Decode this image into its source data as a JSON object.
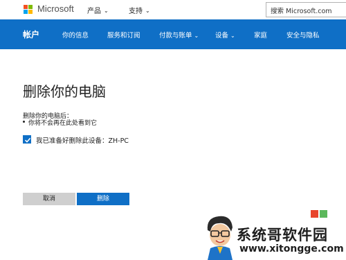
{
  "header": {
    "brand": "Microsoft",
    "nav": [
      {
        "label": "产品",
        "has_dropdown": true
      },
      {
        "label": "支持",
        "has_dropdown": true
      }
    ],
    "search_text": "搜索 Microsoft.com",
    "logo_colors": [
      "#f25022",
      "#7fba00",
      "#00a4ef",
      "#ffb900"
    ]
  },
  "account_nav": {
    "title": "帐户",
    "items": [
      {
        "label": "你的信息",
        "has_dropdown": false
      },
      {
        "label": "服务和订阅",
        "has_dropdown": false
      },
      {
        "label": "付款与账单",
        "has_dropdown": true
      },
      {
        "label": "设备",
        "has_dropdown": true
      },
      {
        "label": "家庭",
        "has_dropdown": false
      },
      {
        "label": "安全与隐私",
        "has_dropdown": false
      }
    ],
    "background": "#0f6fc6"
  },
  "main": {
    "heading": "删除你的电脑",
    "after_label": "删除你的电脑后：",
    "bullets": [
      "你将不会再在此处看到它"
    ],
    "confirm_checkbox": {
      "label": "我已准备好删除此设备：ZH-PC",
      "checked": true
    },
    "cancel_label": "取消",
    "delete_label": "删除"
  },
  "watermark": {
    "title": "系统哥软件园",
    "url": "www.xitongge.com"
  }
}
